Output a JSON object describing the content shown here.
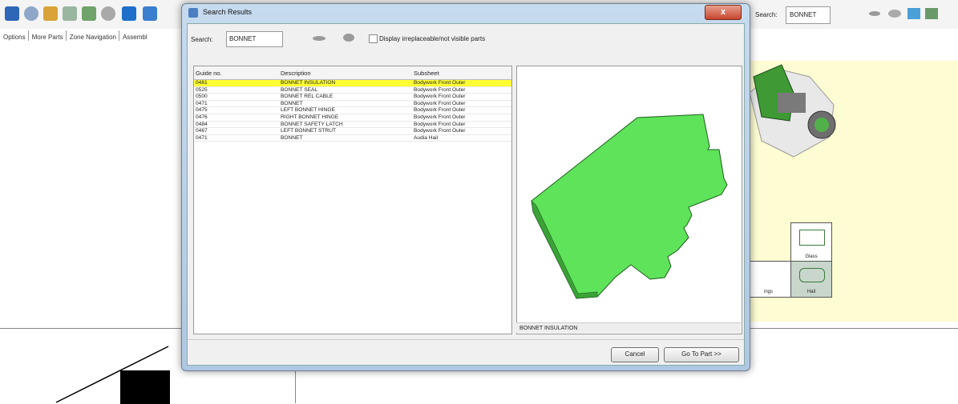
{
  "app": {
    "menubar": [
      "Options",
      "More Parts",
      "Zone Navigation",
      "Assembl"
    ],
    "search_label": "Search:",
    "search_value": "BONNET",
    "zone_tiles": [
      {
        "label": "Glass"
      },
      {
        "label": "ings"
      },
      {
        "label": "Hail"
      }
    ],
    "toolbar_icons": [
      "save-icon",
      "globe-icon",
      "tree-icon",
      "document-icon",
      "pencil-icon",
      "eye-icon",
      "cube-icon",
      "cube-blue-icon"
    ],
    "right_toolbar_icons": [
      "show-icon",
      "hide-icon",
      "window-icon",
      "picture-icon"
    ]
  },
  "dialog": {
    "title": "Search Results",
    "close_label": "x",
    "search_label": "Search:",
    "search_value": "BONNET",
    "checkbox_label": "Display irreplaceable/not visible parts",
    "checkbox_checked": false,
    "table": {
      "headers": [
        "Guide no.",
        "Description",
        "Subsheet"
      ],
      "rows": [
        [
          "0481",
          "BONNET INSULATION",
          "Bodywork Front Outer"
        ],
        [
          "0525",
          "BONNET SEAL",
          "Bodywork Front Outer"
        ],
        [
          "0500",
          "BONNET REL CABLE",
          "Bodywork Front Outer"
        ],
        [
          "0471",
          "BONNET",
          "Bodywork Front Outer"
        ],
        [
          "0475",
          "LEFT BONNET HINGE",
          "Bodywork Front Outer"
        ],
        [
          "0476",
          "RIGHT BONNET HINGE",
          "Bodywork Front Outer"
        ],
        [
          "0484",
          "BONNET SAFETY LATCH",
          "Bodywork Front Outer"
        ],
        [
          "0467",
          "LEFT BONNET STRUT",
          "Bodywork Front Outer"
        ],
        [
          "0471",
          "BONNET",
          "Audia Hail"
        ]
      ],
      "selected_index": 0,
      "selected_color": "#ffff33"
    },
    "preview_caption": "BONNET INSULATION",
    "preview_color": "#5ee35a",
    "cancel_label": "Cancel",
    "goto_label": "Go To Part >>"
  }
}
